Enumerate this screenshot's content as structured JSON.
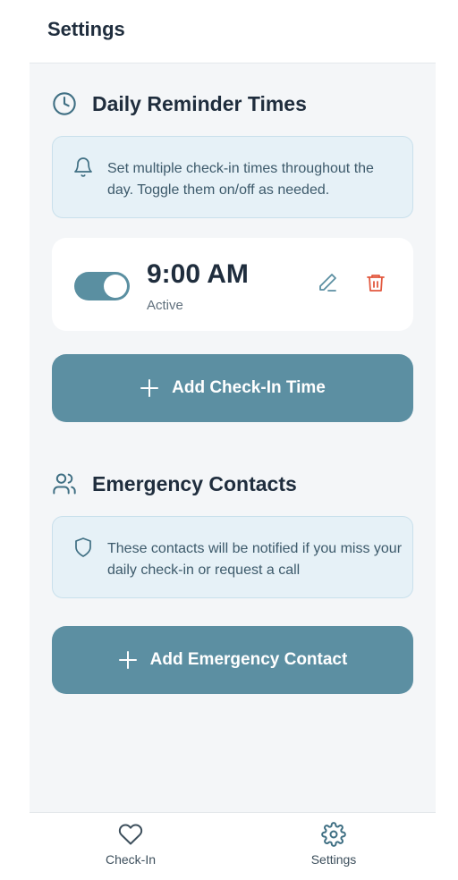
{
  "header": {
    "title": "Settings"
  },
  "reminders": {
    "title": "Daily Reminder Times",
    "info": "Set multiple check-in times throughout the day. Toggle them on/off as needed.",
    "items": [
      {
        "time": "9:00 AM",
        "status": "Active",
        "enabled": true
      }
    ],
    "add_label": "Add Check-In Time"
  },
  "contacts": {
    "title": "Emergency Contacts",
    "info": "These contacts will be notified if you miss your daily check-in or request a call",
    "add_label": "Add Emergency Contact"
  },
  "bottom_nav": {
    "items": [
      {
        "label": "Check-In",
        "icon": "heart-icon"
      },
      {
        "label": "Settings",
        "icon": "gear-icon",
        "active": true
      }
    ]
  },
  "colors": {
    "accent": "#5c8fa2",
    "danger": "#e2583e",
    "info_bg": "#e6f1f7"
  }
}
